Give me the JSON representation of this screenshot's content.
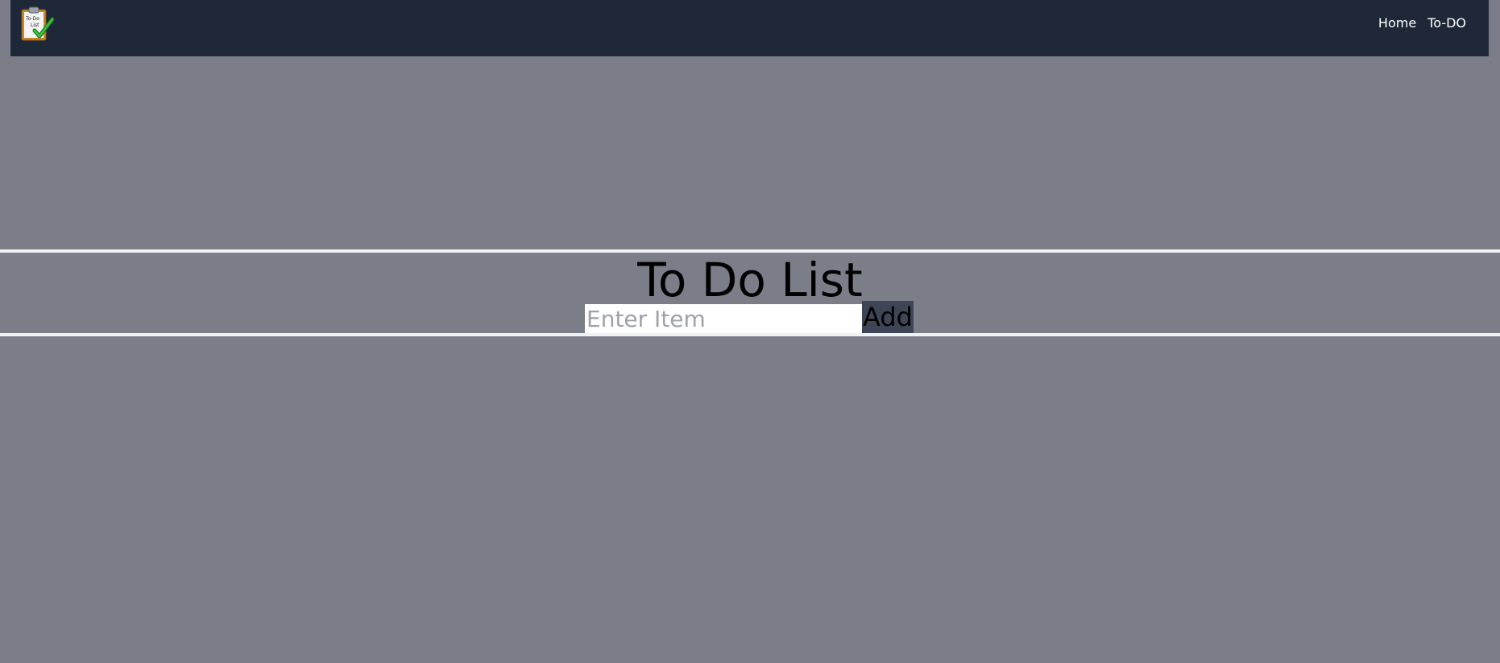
{
  "navbar": {
    "logo_text": "To-Do List",
    "links": [
      {
        "label": "Home"
      },
      {
        "label": "To-DO"
      }
    ]
  },
  "main": {
    "title": "To Do List",
    "input": {
      "placeholder": "Enter Item",
      "value": ""
    },
    "add_label": "Add"
  },
  "colors": {
    "page_background": "#7b7d89",
    "navbar_background": "#1f2838",
    "nav_link_text": "#ffffff",
    "rule": "#f2f2f2",
    "input_background": "#ffffff",
    "placeholder_text": "#9ea1ab",
    "add_button_background": "#3d4556"
  }
}
